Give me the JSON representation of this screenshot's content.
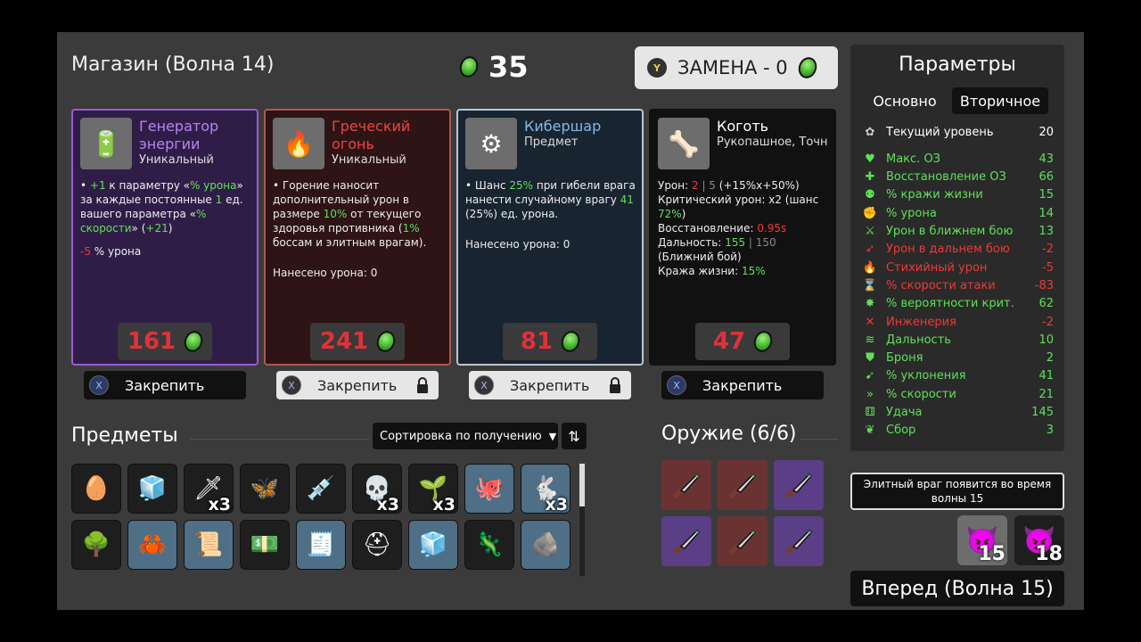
{
  "header": {
    "shop_title": "Магазин (Волна 14)",
    "money": "35",
    "reroll_button_hint": "Y",
    "reroll_label": "ЗАМЕНА - 0"
  },
  "cards": [
    {
      "name": "Генератор энергии",
      "rarity": "Уникальный",
      "icon": "generator-icon",
      "desc": [
        {
          "parts": [
            {
              "t": "+1",
              "c": "g"
            },
            {
              "t": " к параметру «"
            },
            {
              "t": "% урона",
              "c": "g"
            },
            {
              "t": "» за каждые постоянные "
            },
            {
              "t": "1",
              "c": "g"
            },
            {
              "t": " ед. вашего параметра «"
            },
            {
              "t": "% скорости",
              "c": "g"
            },
            {
              "t": "» ("
            },
            {
              "t": "+21",
              "c": "g"
            },
            {
              "t": ")"
            }
          ]
        },
        {
          "parts": [
            {
              "t": "-5",
              "c": "r"
            },
            {
              "t": " % урона"
            }
          ]
        }
      ],
      "price": "161",
      "lock_label": "Закрепить",
      "locked": false
    },
    {
      "name": "Греческий огонь",
      "rarity": "Уникальный",
      "icon": "torch-icon",
      "desc": [
        {
          "parts": [
            {
              "t": "Горение наносит дополнительный урон в размере "
            },
            {
              "t": "10%",
              "c": "g"
            },
            {
              "t": " от текущего здоровья противника ("
            },
            {
              "t": "1%",
              "c": "g"
            },
            {
              "t": " боссам и элитным врагам)."
            }
          ]
        },
        {
          "parts": [
            {
              "t": "Нанесено урона: 0"
            }
          ]
        }
      ],
      "price": "241",
      "lock_label": "Закрепить",
      "locked": true
    },
    {
      "name": "Кибершар",
      "rarity": "Предмет",
      "icon": "cyberball-icon",
      "desc": [
        {
          "parts": [
            {
              "t": "Шанс "
            },
            {
              "t": "25%",
              "c": "g"
            },
            {
              "t": " при гибели врага нанести случайному врагу "
            },
            {
              "t": "41",
              "c": "g"
            },
            {
              "t": " (25%) ед. урона."
            }
          ]
        },
        {
          "parts": [
            {
              "t": "Нанесено урона: 0"
            }
          ]
        }
      ],
      "price": "81",
      "lock_label": "Закрепить",
      "locked": true
    },
    {
      "name": "Коготь",
      "rarity": "Рукопашное, Точн",
      "icon": "claw-icon",
      "desc": [
        {
          "parts": [
            {
              "t": "Урон: "
            },
            {
              "t": "2",
              "c": "r"
            },
            {
              "t": " | 5 ",
              "c": "gr"
            },
            {
              "t": "(+15%x+50%)"
            }
          ]
        },
        {
          "parts": [
            {
              "t": "Критический урон: x2 (шанс "
            },
            {
              "t": "72%",
              "c": "g"
            },
            {
              "t": ")"
            }
          ]
        },
        {
          "parts": [
            {
              "t": "Восстановление: "
            },
            {
              "t": "0.95s",
              "c": "r"
            }
          ]
        },
        {
          "parts": [
            {
              "t": "Дальность: "
            },
            {
              "t": "155",
              "c": "g"
            },
            {
              "t": " | 150",
              "c": "gr"
            }
          ]
        },
        {
          "parts": [
            {
              "t": "(Ближний бой)"
            }
          ]
        },
        {
          "parts": [
            {
              "t": "Кража жизни: "
            },
            {
              "t": "15%",
              "c": "g"
            }
          ]
        }
      ],
      "price": "47",
      "lock_label": "Закрепить",
      "locked": false
    }
  ],
  "lock_button_hint": "X",
  "items": {
    "title": "Предметы",
    "sort_label": "Сортировка по получению",
    "row1": [
      {
        "icon": "egg-mask-icon",
        "glyph": "🥚",
        "style": "",
        "count": ""
      },
      {
        "icon": "slime-icon",
        "glyph": "🧊",
        "style": "",
        "count": ""
      },
      {
        "icon": "red-arrow-icon",
        "glyph": "🗡",
        "style": "",
        "count": "x3"
      },
      {
        "icon": "butterfly-icon",
        "glyph": "🦋",
        "style": "",
        "count": ""
      },
      {
        "icon": "syringe-icon",
        "glyph": "💉",
        "style": "",
        "count": ""
      },
      {
        "icon": "skull-icon",
        "glyph": "💀",
        "style": "",
        "count": "x3"
      },
      {
        "icon": "sprout-icon",
        "glyph": "🌱",
        "style": "",
        "count": "x3"
      },
      {
        "icon": "tentacle-icon",
        "glyph": "🐙",
        "style": "blue",
        "count": ""
      },
      {
        "icon": "rabbit-icon",
        "glyph": "🐇",
        "style": "blue",
        "count": "x3"
      }
    ],
    "row2": [
      {
        "icon": "tree-icon",
        "glyph": "🌳",
        "style": "",
        "count": ""
      },
      {
        "icon": "antlers-icon",
        "glyph": "🦀",
        "style": "blue",
        "count": ""
      },
      {
        "icon": "scroll-icon",
        "glyph": "📜",
        "style": "blue",
        "count": ""
      },
      {
        "icon": "banknote-icon",
        "glyph": "💵",
        "style": "",
        "count": ""
      },
      {
        "icon": "cash-register-icon",
        "glyph": "🧾",
        "style": "blue",
        "count": ""
      },
      {
        "icon": "helmet-icon",
        "glyph": "⛑",
        "style": "",
        "count": ""
      },
      {
        "icon": "ice-cube-icon",
        "glyph": "🧊",
        "style": "blue",
        "count": ""
      },
      {
        "icon": "lizard-icon",
        "glyph": "🦎",
        "style": "",
        "count": ""
      },
      {
        "icon": "stone-icon",
        "glyph": "🪨",
        "style": "blue",
        "count": ""
      }
    ]
  },
  "weapons": {
    "title": "Оружие (6/6)",
    "slots": [
      "wred",
      "wred",
      "wpur",
      "wpur",
      "wred",
      "wpur"
    ]
  },
  "stats": {
    "title": "Параметры",
    "tab_main": "Основно",
    "tab_secondary": "Вторичное",
    "rows": [
      {
        "icon": "level-icon",
        "glyph": "✿",
        "name": "Текущий уровень",
        "value": "20",
        "color": "#ffffff"
      },
      {
        "icon": "heart-icon",
        "glyph": "♥",
        "name": "Макс. ОЗ",
        "value": "43",
        "color": "#5fe058"
      },
      {
        "icon": "regen-icon",
        "glyph": "✚",
        "name": "Восстановление ОЗ",
        "value": "66",
        "color": "#5fe058"
      },
      {
        "icon": "lifesteal-icon",
        "glyph": "⚉",
        "name": "% кражи жизни",
        "value": "15",
        "color": "#5fe058"
      },
      {
        "icon": "damage-icon",
        "glyph": "✊",
        "name": "% урона",
        "value": "14",
        "color": "#5fe058"
      },
      {
        "icon": "melee-icon",
        "glyph": "⚔",
        "name": "Урон в ближнем бою",
        "value": "13",
        "color": "#5fe058"
      },
      {
        "icon": "ranged-icon",
        "glyph": "➶",
        "name": "Урон в дальнем бою",
        "value": "-2",
        "color": "#ee3838"
      },
      {
        "icon": "elemental-icon",
        "glyph": "🔥",
        "name": "Стихийный урон",
        "value": "-5",
        "color": "#ee3838"
      },
      {
        "icon": "attack-speed-icon",
        "glyph": "⌛",
        "name": "% скорости атаки",
        "value": "-83",
        "color": "#ee3838"
      },
      {
        "icon": "crit-icon",
        "glyph": "✸",
        "name": "% вероятности крит. у...",
        "value": "62",
        "color": "#5fe058"
      },
      {
        "icon": "engineering-icon",
        "glyph": "✕",
        "name": "Инженерия",
        "value": "-2",
        "color": "#ee3838"
      },
      {
        "icon": "range-icon",
        "glyph": "≋",
        "name": "Дальность",
        "value": "10",
        "color": "#5fe058"
      },
      {
        "icon": "armor-icon",
        "glyph": "⛊",
        "name": "Броня",
        "value": "2",
        "color": "#5fe058"
      },
      {
        "icon": "dodge-icon",
        "glyph": "➹",
        "name": "% уклонения",
        "value": "41",
        "color": "#5fe058"
      },
      {
        "icon": "speed-icon",
        "glyph": "»",
        "name": "% скорости",
        "value": "21",
        "color": "#5fe058"
      },
      {
        "icon": "luck-icon",
        "glyph": "⚅",
        "name": "Удача",
        "value": "145",
        "color": "#5fe058"
      },
      {
        "icon": "harvest-icon",
        "glyph": "❦",
        "name": "Сбор",
        "value": "3",
        "color": "#5fe058"
      }
    ]
  },
  "elite_notice": "Элитный враг появится во время волны 15",
  "bosses": [
    "15",
    "18"
  ],
  "go_button": "Вперед (Волна 15)"
}
